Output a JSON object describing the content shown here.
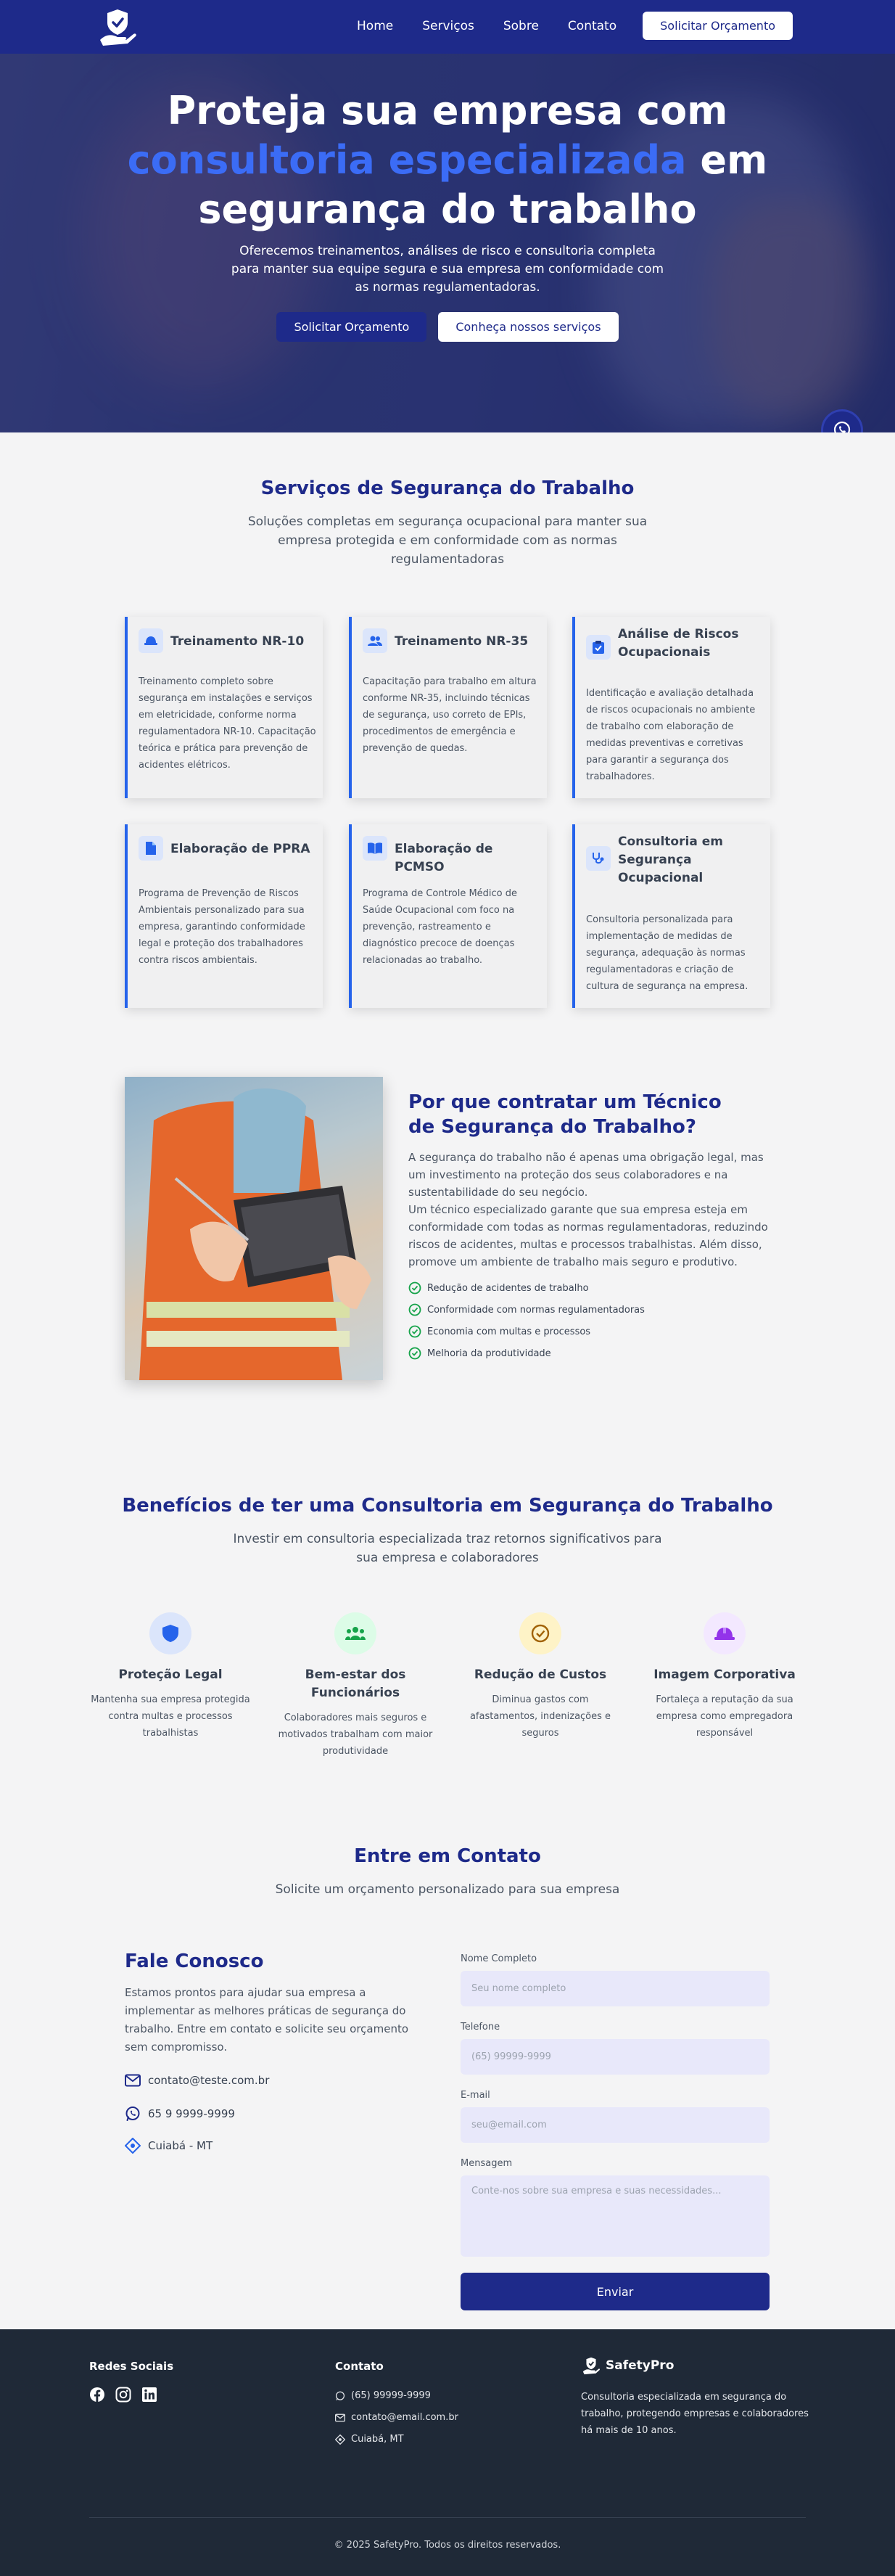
{
  "colors": {
    "brand": "#1e2a8a",
    "accent": "#2563eb",
    "success": "#16a34a"
  },
  "nav": {
    "logo_icon": "hand-shield-check-icon",
    "links": [
      "Home",
      "Serviços",
      "Sobre",
      "Contato"
    ],
    "cta": "Solicitar Orçamento"
  },
  "hero": {
    "title_part1": "Proteja sua empresa com ",
    "title_accent": "consultoria especializada",
    "title_part2": " em segurança do trabalho",
    "subtitle": "Oferecemos treinamentos, análises de risco e consultoria completa para manter sua equipe segura e sua empresa em conformidade com as normas regulamentadoras.",
    "primary_button": "Solicitar Orçamento",
    "secondary_button": "Conheça nossos serviços"
  },
  "services": {
    "title": "Serviços de Segurança do Trabalho",
    "subtitle": "Soluções completas em segurança ocupacional para manter sua empresa protegida e em conformidade com as normas regulamentadoras",
    "items": [
      {
        "icon": "hard-hat-icon",
        "title": "Treinamento NR-10",
        "text": "Treinamento completo sobre segurança em instalações e serviços em eletricidade, conforme norma regulamentadora NR-10. Capacitação teórica e prática para prevenção de acidentes elétricos."
      },
      {
        "icon": "users-icon",
        "title": "Treinamento NR-35",
        "text": "Capacitação para trabalho em altura conforme NR-35, incluindo técnicas de segurança, uso correto de EPIs, procedimentos de emergência e prevenção de quedas."
      },
      {
        "icon": "clipboard-check-icon",
        "title": "Análise de Riscos Ocupacionais",
        "text": "Identificação e avaliação detalhada de riscos ocupacionais no ambiente de trabalho com elaboração de medidas preventivas e corretivas para garantir a segurança dos trabalhadores."
      },
      {
        "icon": "document-icon",
        "title": "Elaboração de PPRA",
        "text": "Programa de Prevenção de Riscos Ambientais personalizado para sua empresa, garantindo conformidade legal e proteção dos trabalhadores contra riscos ambientais."
      },
      {
        "icon": "book-icon",
        "title": "Elaboração de PCMSO",
        "text": "Programa de Controle Médico de Saúde Ocupacional com foco na prevenção, rastreamento e diagnóstico precoce de doenças relacionadas ao trabalho."
      },
      {
        "icon": "stethoscope-icon",
        "title": "Consultoria em Segurança Ocupacional",
        "text": "Consultoria personalizada para implementação de medidas de segurança, adequação às normas regulamentadoras e criação de cultura de segurança na empresa."
      }
    ]
  },
  "why": {
    "title": "Por que contratar um Técnico de Segurança do Trabalho?",
    "para1": "A segurança do trabalho não é apenas uma obrigação legal, mas um investimento na proteção dos seus colaboradores e na sustentabilidade do seu negócio.",
    "para2": "Um técnico especializado garante que sua empresa esteja em conformidade com todas as normas regulamentadoras, reduzindo riscos de acidentes, multas e processos trabalhistas. Além disso, promove um ambiente de trabalho mais seguro e produtivo.",
    "checks": [
      "Redução de acidentes de trabalho",
      "Conformidade com normas regulamentadoras",
      "Economia com multas e processos",
      "Melhoria da produtividade"
    ]
  },
  "benefits": {
    "title": "Benefícios de ter uma Consultoria em Segurança do Trabalho",
    "subtitle": "Investir em consultoria especializada traz retornos significativos para sua empresa e colaboradores",
    "items": [
      {
        "icon": "shield-icon",
        "title": "Proteção Legal",
        "text": "Mantenha sua empresa protegida contra multas e processos trabalhistas",
        "bg": "#dbe5fb",
        "fg": "#2563eb"
      },
      {
        "icon": "people-icon",
        "title": "Bem-estar dos Funcionários",
        "text": "Colaboradores mais seguros e motivados trabalham com maior produtividade",
        "bg": "#dcfce7",
        "fg": "#16a34a"
      },
      {
        "icon": "check-circle-icon",
        "title": "Redução de Custos",
        "text": "Diminua gastos com afastamentos, indenizações e seguros",
        "bg": "#fef3c7",
        "fg": "#a16207"
      },
      {
        "icon": "helmet-icon",
        "title": "Imagem Corporativa",
        "text": "Fortaleça a reputação da sua empresa como empregadora responsável",
        "bg": "#f3e8ff",
        "fg": "#9333ea"
      }
    ]
  },
  "contact": {
    "title": "Entre em Contato",
    "subtitle": "Solicite um orçamento personalizado para sua empresa",
    "heading": "Fale Conosco",
    "text": "Estamos prontos para ajudar sua empresa a implementar as melhores práticas de segurança do trabalho. Entre em contato e solicite seu orçamento sem compromisso.",
    "email": "contato@teste.com.br",
    "phone": "65 9 9999-9999",
    "location": "Cuiabá - MT",
    "form": {
      "name_label": "Nome Completo",
      "name_placeholder": "Seu nome completo",
      "phone_label": "Telefone",
      "phone_placeholder": "(65) 99999-9999",
      "email_label": "E-mail",
      "email_placeholder": "seu@email.com",
      "message_label": "Mensagem",
      "message_placeholder": "Conte-nos sobre sua empresa e suas necessidades...",
      "submit": "Enviar"
    }
  },
  "footer": {
    "social_title": "Redes Sociais",
    "social_icons": [
      "facebook-icon",
      "instagram-icon",
      "linkedin-icon"
    ],
    "contact_title": "Contato",
    "phone": "(65) 99999-9999",
    "email": "contato@email.com.br",
    "location": "Cuiabá, MT",
    "brand": "SafetyPro",
    "brand_text": "Consultoria especializada em segurança do trabalho, protegendo empresas e colaboradores há mais de 10 anos.",
    "copyright": "© 2025 SafetyPro. Todos os direitos reservados."
  }
}
